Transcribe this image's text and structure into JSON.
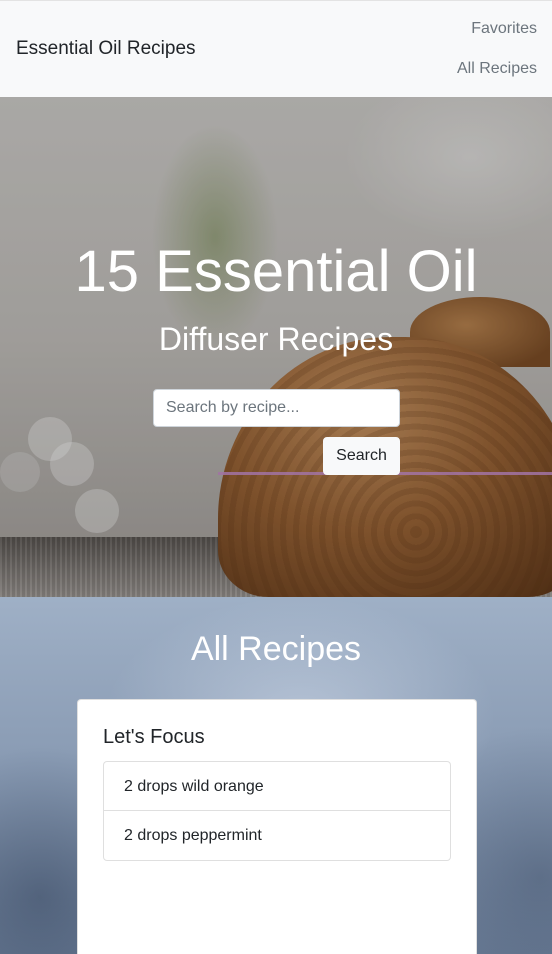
{
  "navbar": {
    "brand": "Essential Oil Recipes",
    "links": [
      "Favorites",
      "All Recipes"
    ]
  },
  "hero": {
    "title": "15 Essential Oil",
    "subtitle": "Diffuser Recipes",
    "search": {
      "placeholder": "Search by recipe...",
      "value": "",
      "button_label": "Search"
    }
  },
  "recipes": {
    "heading": "All Recipes",
    "cards": [
      {
        "title": "Let's Focus",
        "ingredients": [
          "2 drops wild orange",
          "2 drops peppermint"
        ]
      }
    ]
  }
}
